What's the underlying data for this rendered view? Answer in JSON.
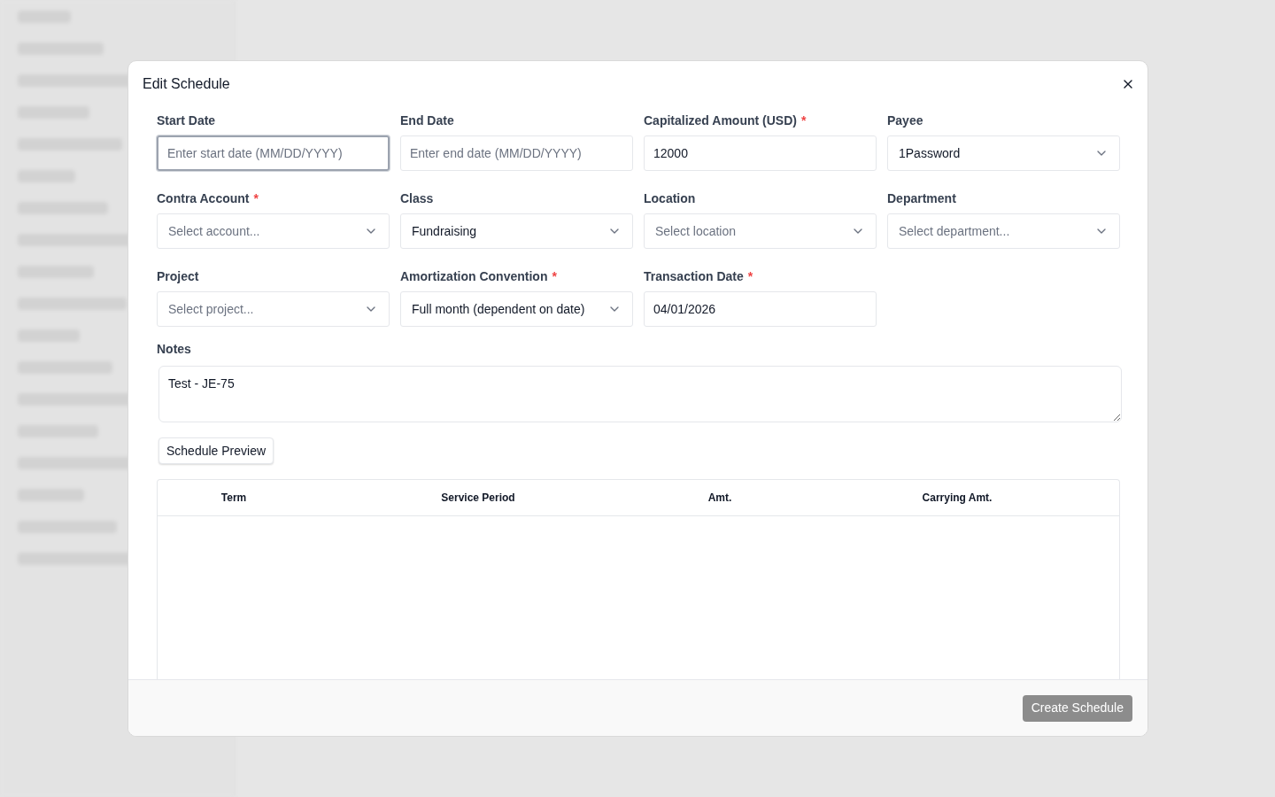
{
  "dialog": {
    "title": "Edit Schedule",
    "fields": [
      {
        "label": "Start Date",
        "kind": "text",
        "placeholder": "Enter start date (MM/DD/YYYY)",
        "focused": true
      },
      {
        "label": "End Date",
        "kind": "text",
        "placeholder": "Enter end date (MM/DD/YYYY)",
        "focused": false
      },
      {
        "label": "Capitalized Amount (USD)",
        "required_mark": "*",
        "kind": "text",
        "value": "12000",
        "focused": false
      },
      {
        "label": "Payee",
        "kind": "select",
        "value": "1Password",
        "focused": false
      },
      {
        "label": "Contra Account",
        "required_mark": "*",
        "kind": "select",
        "placeholder": "Select account...",
        "focused": false
      },
      {
        "label": "Class",
        "kind": "select",
        "value": "Fundraising",
        "focused": false
      },
      {
        "label": "Location",
        "kind": "select",
        "placeholder": "Select location",
        "focused": false
      },
      {
        "label": "Department",
        "kind": "select",
        "placeholder": "Select department...",
        "focused": false
      },
      {
        "label": "Project",
        "kind": "select",
        "placeholder": "Select project...",
        "focused": false
      },
      {
        "label": "Amortization Convention",
        "required_mark": "*",
        "kind": "select",
        "value": "Full month (dependent on date)",
        "focused": false
      },
      {
        "label": "Transaction Date",
        "required_mark": "*",
        "kind": "text",
        "value": "04/01/2026",
        "focused": false
      }
    ],
    "notes": {
      "label": "Notes",
      "value": "Test - JE-75"
    },
    "preview_button": "Schedule Preview",
    "table": {
      "columns": [
        "Term",
        "Service Period",
        "Amt.",
        "Carrying Amt."
      ]
    },
    "submit": {
      "label": "Create Schedule",
      "disabled": true
    }
  }
}
